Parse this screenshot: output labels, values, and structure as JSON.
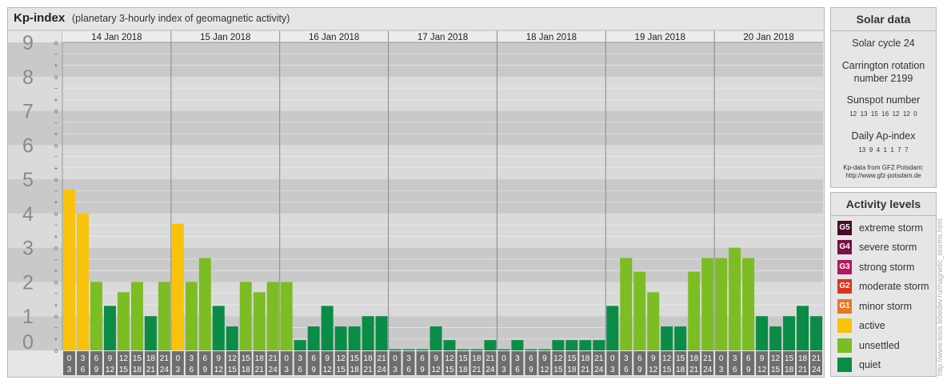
{
  "header": {
    "title": "Kp-index",
    "subtitle": "(planetary 3-hourly index of geomagnetic activity)"
  },
  "solar": {
    "title": "Solar data",
    "cycle": "Solar cycle 24",
    "carrington_line1": "Carrington rotation",
    "carrington_line2": "number 2199",
    "sunspot_label": "Sunspot number",
    "sunspot_values": "12  13  15  16  12  12  0",
    "ap_label": "Daily Ap-index",
    "ap_values": "13  9  4  1  1  7  7",
    "source_line1": "Kp-data from GFZ Potsdam:",
    "source_line2": "http://www.gfz-potsdam.de"
  },
  "activity": {
    "title": "Activity levels",
    "levels": [
      {
        "code": "G5",
        "label": "extreme storm",
        "color": "#4a0a2a"
      },
      {
        "code": "G4",
        "label": "severe storm",
        "color": "#7a1045"
      },
      {
        "code": "G3",
        "label": "strong storm",
        "color": "#b5175f"
      },
      {
        "code": "G2",
        "label": "moderate storm",
        "color": "#d9361f"
      },
      {
        "code": "G1",
        "label": "minor storm",
        "color": "#e87722"
      },
      {
        "code": "",
        "label": "active",
        "color": "#f8c30a"
      },
      {
        "code": "",
        "label": "unsettled",
        "color": "#7cbd23"
      },
      {
        "code": "",
        "label": "quiet",
        "color": "#0a8c46"
      }
    ]
  },
  "watermark": "http://www.tesis.lebedev.ru/magnetic_storms.html",
  "chart_data": {
    "type": "bar",
    "ylim": [
      0,
      9
    ],
    "y_ticks": [
      "0",
      "1",
      "2",
      "3",
      "4",
      "5",
      "6",
      "7",
      "8",
      "9"
    ],
    "y_subticks": [
      "o",
      "+",
      "−"
    ],
    "days": [
      "14 Jan 2018",
      "15 Jan 2018",
      "16 Jan 2018",
      "17 Jan 2018",
      "18 Jan 2018",
      "19 Jan 2018",
      "20 Jan 2018"
    ],
    "hour_starts": [
      "0",
      "3",
      "6",
      "9",
      "12",
      "15",
      "18",
      "21"
    ],
    "hour_ends": [
      "3",
      "6",
      "9",
      "12",
      "15",
      "18",
      "21",
      "24"
    ],
    "values": [
      [
        4.7,
        4.0,
        2.0,
        1.3,
        1.7,
        2.0,
        1.0,
        2.0
      ],
      [
        3.7,
        2.0,
        2.7,
        1.3,
        0.7,
        2.0,
        1.7,
        2.0
      ],
      [
        2.0,
        0.3,
        0.7,
        1.3,
        0.7,
        0.7,
        1.0,
        1.0
      ],
      [
        0.0,
        0.0,
        0.0,
        0.7,
        0.3,
        0.0,
        0.0,
        0.3
      ],
      [
        0.0,
        0.3,
        0.0,
        0.0,
        0.3,
        0.3,
        0.3,
        0.3
      ],
      [
        1.3,
        2.7,
        2.3,
        1.7,
        0.7,
        0.7,
        2.3,
        2.7
      ],
      [
        2.7,
        3.0,
        2.7,
        1.0,
        0.7,
        1.0,
        1.3,
        1.0
      ]
    ],
    "color_thresholds": [
      {
        "min": 5.0,
        "color": "#e87722"
      },
      {
        "min": 3.7,
        "color": "#f8c30a"
      },
      {
        "min": 1.7,
        "color": "#7cbd23"
      },
      {
        "min": 0.0,
        "color": "#0a8c46"
      }
    ],
    "band_colors": [
      "#c9c9c9",
      "#dadada"
    ],
    "grid_color": "#efefef"
  }
}
